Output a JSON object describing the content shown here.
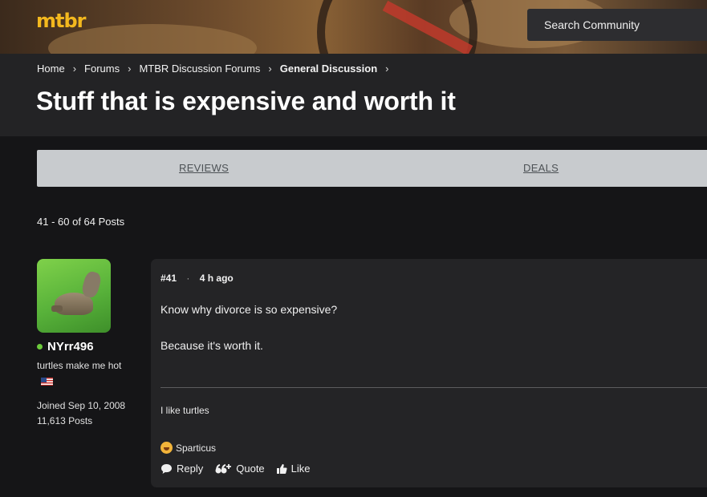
{
  "header": {
    "logo_text": "mtbr",
    "search_placeholder": "Search Community"
  },
  "breadcrumb": {
    "items": [
      "Home",
      "Forums",
      "MTBR Discussion Forums",
      "General Discussion"
    ]
  },
  "thread": {
    "title": "Stuff that is expensive and worth it"
  },
  "tabs": {
    "reviews": "REVIEWS",
    "deals": "DEALS"
  },
  "pagination": {
    "posts_range": "41 - 60 of 64 Posts"
  },
  "author": {
    "name": "NYrr496",
    "title": "turtles make me hot",
    "flag": "us-flag-icon",
    "joined": "Joined Sep 10, 2008",
    "posts": "11,613 Posts",
    "online_color": "#6ccb3c"
  },
  "post": {
    "number": "#41",
    "time": "4 h ago",
    "body_line1": "Know why divorce is so expensive?",
    "body_line2": "Because it's worth it.",
    "signature": "I like turtles",
    "reaction_user": "Sparticus",
    "reaction_icon": "laughing-emoji-icon"
  },
  "actions": {
    "reply": "Reply",
    "quote": "Quote",
    "like": "Like"
  },
  "colors": {
    "brand": "#f3b81e",
    "background": "#151517",
    "card": "#242426",
    "tab_bar": "#c8cbce"
  }
}
